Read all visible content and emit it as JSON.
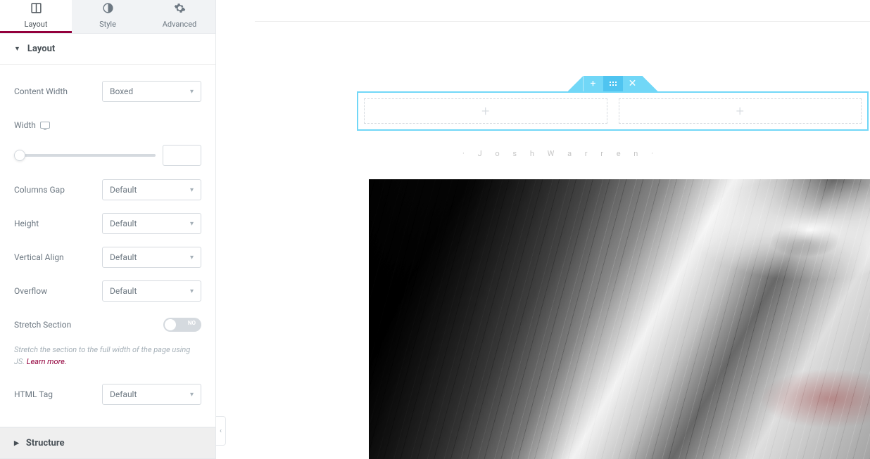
{
  "tabs": {
    "layout": {
      "label": "Layout"
    },
    "style": {
      "label": "Style"
    },
    "advanced": {
      "label": "Advanced"
    }
  },
  "accordion": {
    "layout_title": "Layout",
    "structure_title": "Structure"
  },
  "controls": {
    "content_width_label": "Content Width",
    "content_width_value": "Boxed",
    "width_label": "Width",
    "width_value": "",
    "columns_gap_label": "Columns Gap",
    "columns_gap_value": "Default",
    "height_label": "Height",
    "height_value": "Default",
    "vertical_align_label": "Vertical Align",
    "vertical_align_value": "Default",
    "overflow_label": "Overflow",
    "overflow_value": "Default",
    "stretch_label": "Stretch Section",
    "stretch_toggle_text": "NO",
    "stretch_hint_a": "Stretch the section to the full width of the page using JS. ",
    "stretch_hint_link": "Learn more.",
    "html_tag_label": "HTML Tag",
    "html_tag_value": "Default"
  },
  "canvas": {
    "caption": "· J o s h   W a r r e n ·"
  }
}
